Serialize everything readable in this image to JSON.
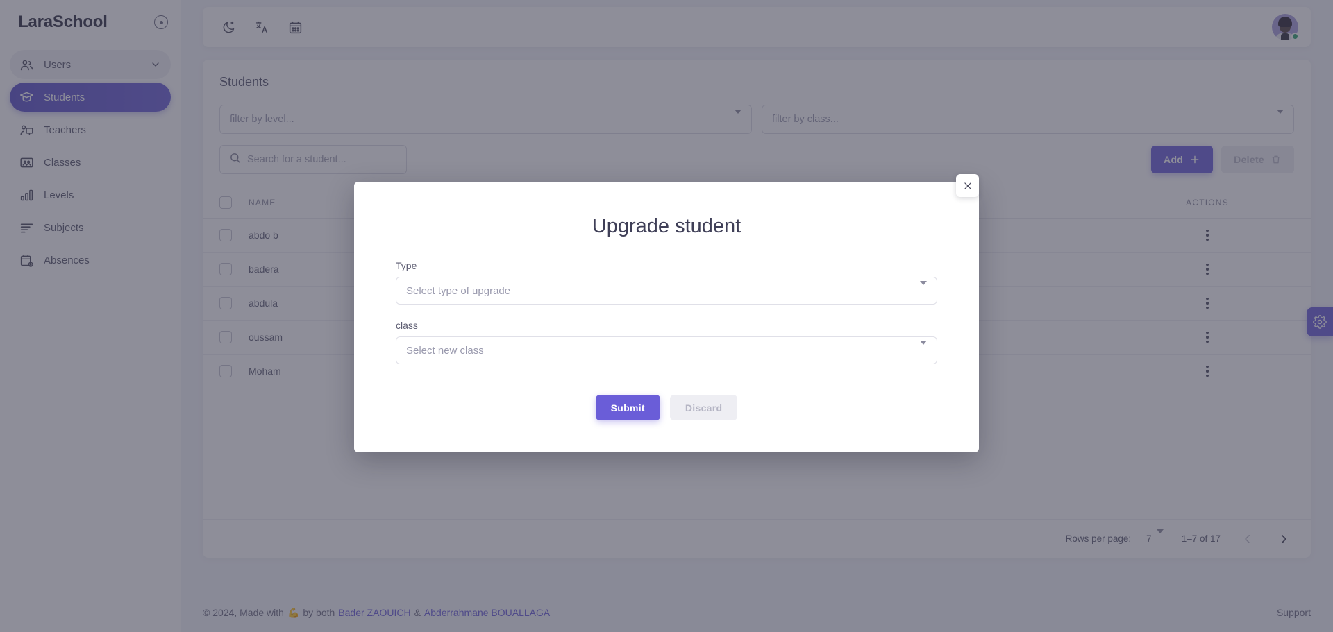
{
  "brand": {
    "name": "LaraSchool",
    "collapse_icon": "circle-dot-icon"
  },
  "sidebar": {
    "items": [
      {
        "label": "Users",
        "icon": "users-icon",
        "type": "group",
        "chevron": "chevron-down-icon"
      },
      {
        "label": "Students",
        "icon": "student-cap-icon",
        "type": "active"
      },
      {
        "label": "Teachers",
        "icon": "teacher-icon",
        "type": "item"
      },
      {
        "label": "Classes",
        "icon": "classroom-icon",
        "type": "item"
      },
      {
        "label": "Levels",
        "icon": "bar-chart-icon",
        "type": "item"
      },
      {
        "label": "Subjects",
        "icon": "lines-icon",
        "type": "item"
      },
      {
        "label": "Absences",
        "icon": "calendar-check-icon",
        "type": "item"
      }
    ]
  },
  "topbar": {
    "icons": [
      {
        "name": "moon-icon",
        "title": "Dark mode"
      },
      {
        "name": "translate-icon",
        "title": "Language"
      },
      {
        "name": "calendar-icon",
        "title": "Calendar"
      }
    ],
    "avatar": {
      "name": "user-avatar",
      "status": "online"
    }
  },
  "page": {
    "title": "Students",
    "filters": [
      {
        "name": "filter-level",
        "placeholder": "filter by level...",
        "value": ""
      },
      {
        "name": "filter-class",
        "placeholder": "filter by class...",
        "value": ""
      }
    ],
    "search": {
      "placeholder": "Search for a student...",
      "value": "",
      "icon": "search-icon"
    },
    "add_label": "Add",
    "add_icon": "plus-icon",
    "delete_label": "Delete",
    "delete_icon": "trash-icon"
  },
  "table": {
    "columns": [
      "NAME",
      "ACTIONS"
    ],
    "rows": [
      {
        "name": "abdo b",
        "actions": "more-vertical-icon"
      },
      {
        "name": "badera",
        "actions": "more-vertical-icon"
      },
      {
        "name": "abdula",
        "actions": "more-vertical-icon"
      },
      {
        "name": "oussam",
        "actions": "more-vertical-icon"
      },
      {
        "name": "Moham",
        "actions": "more-vertical-icon"
      }
    ]
  },
  "pagination": {
    "rows_per_page_label": "Rows per page:",
    "rows_per_page_value": "7",
    "range_label": "1–7 of 17",
    "prev_icon": "chevron-left-icon",
    "next_icon": "chevron-right-icon"
  },
  "footer": {
    "prefix": "© 2024, Made with",
    "emoji": "💪",
    "middle": "by both",
    "author_one": "Bader ZAOUICH",
    "separator": "&",
    "author_two": "Abderrahmane BOUALLAGA",
    "support": "Support"
  },
  "settings_tab": {
    "icon": "gear-icon"
  },
  "modal": {
    "title": "Upgrade student",
    "close_icon": "close-icon",
    "fields": [
      {
        "label": "Type",
        "placeholder": "Select type of upgrade",
        "value": ""
      },
      {
        "label": "class",
        "placeholder": "Select new class",
        "value": ""
      }
    ],
    "submit_label": "Submit",
    "discard_label": "Discard"
  },
  "colors": {
    "accent": "#6a5dd8",
    "accent_dark": "#5a50c8",
    "status_online": "#2ea36f",
    "page_bg": "#f4f5fa",
    "overlay": "rgba(60,60,80,0.58)"
  }
}
